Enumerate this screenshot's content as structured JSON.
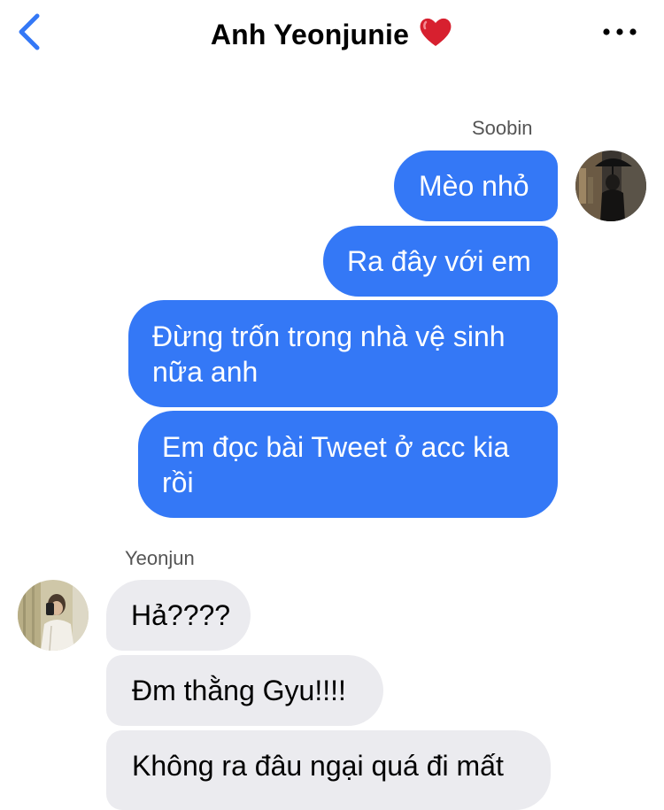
{
  "header": {
    "back_icon": "chevron-left-icon",
    "title": "Anh Yeonjunie",
    "title_emoji": "red-heart-icon",
    "more_icon": "ellipsis-icon",
    "accent_color": "#3478f6"
  },
  "messages": {
    "soobin": {
      "name": "Soobin",
      "bubble_color": "#3478f6",
      "texts": [
        "Mèo nhỏ",
        "Ra đây với em",
        "Đừng trốn trong nhà vệ sinh nữa anh",
        "Em đọc bài Tweet ở acc kia rồi"
      ]
    },
    "yeonjun": {
      "name": "Yeonjun",
      "bubble_color": "#ebebef",
      "texts": [
        "Hả????",
        "Đm thằng Gyu!!!!",
        "Không ra đâu ngại quá đi mất"
      ]
    }
  }
}
